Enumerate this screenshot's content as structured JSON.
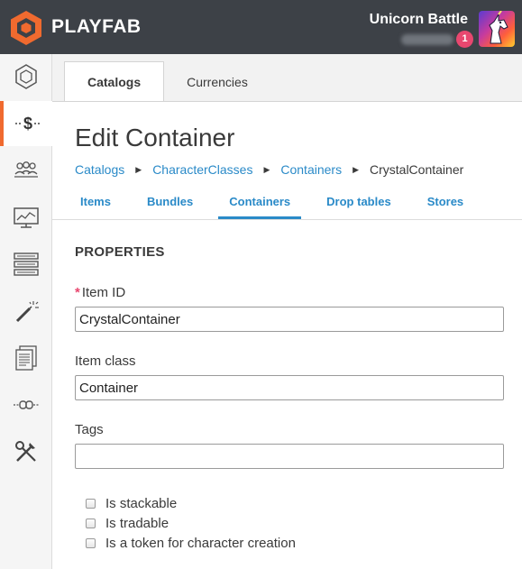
{
  "brand": {
    "name": "PLAYFAB",
    "accent": "#f06a2f"
  },
  "header": {
    "game_title": "Unicorn Battle",
    "notification_count": "1"
  },
  "sidebar": {
    "items": [
      {
        "icon": "hexagon-icon",
        "active": false
      },
      {
        "icon": "dollar-icon",
        "active": true
      },
      {
        "icon": "players-icon",
        "active": false
      },
      {
        "icon": "analytics-monitor-icon",
        "active": false
      },
      {
        "icon": "server-stack-icon",
        "active": false
      },
      {
        "icon": "automation-wand-icon",
        "active": false
      },
      {
        "icon": "documents-icon",
        "active": false
      },
      {
        "icon": "addons-icon",
        "active": false
      },
      {
        "icon": "tools-icon",
        "active": false
      }
    ]
  },
  "top_tabs": [
    {
      "label": "Catalogs",
      "active": true
    },
    {
      "label": "Currencies",
      "active": false
    }
  ],
  "page": {
    "title": "Edit Container"
  },
  "breadcrumb": [
    {
      "label": "Catalogs",
      "link": true
    },
    {
      "label": "CharacterClasses",
      "link": true
    },
    {
      "label": "Containers",
      "link": true
    },
    {
      "label": "CrystalContainer",
      "link": false
    }
  ],
  "sub_tabs": [
    {
      "label": "Items",
      "active": false
    },
    {
      "label": "Bundles",
      "active": false
    },
    {
      "label": "Containers",
      "active": true
    },
    {
      "label": "Drop tables",
      "active": false
    },
    {
      "label": "Stores",
      "active": false
    }
  ],
  "form": {
    "section_title": "PROPERTIES",
    "item_id": {
      "label": "Item ID",
      "required_marker": "*",
      "value": "CrystalContainer"
    },
    "item_class": {
      "label": "Item class",
      "value": "Container"
    },
    "tags": {
      "label": "Tags",
      "value": ""
    },
    "checkboxes": [
      {
        "label": "Is stackable",
        "checked": false
      },
      {
        "label": "Is tradable",
        "checked": false
      },
      {
        "label": "Is a token for character creation",
        "checked": false
      }
    ]
  }
}
